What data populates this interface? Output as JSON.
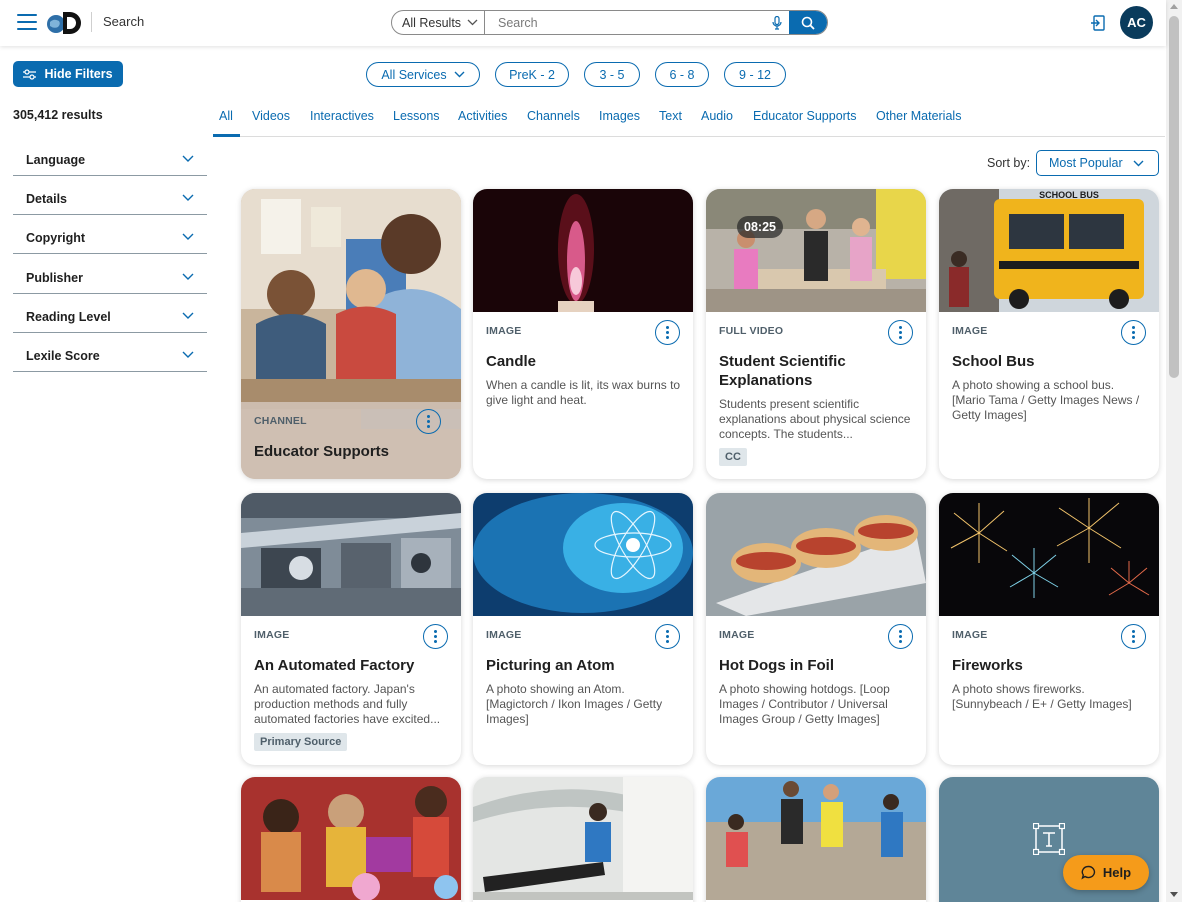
{
  "header": {
    "app_title": "Search",
    "search_scope": "All Results",
    "search_placeholder": "Search",
    "avatar_initials": "AC"
  },
  "filters_bar": {
    "hide_filters_label": "Hide Filters",
    "pills": [
      "All Services",
      "PreK - 2",
      "3 - 5",
      "6 - 8",
      "9 - 12"
    ]
  },
  "results_count": "305,412 results",
  "tabs": [
    "All",
    "Videos",
    "Interactives",
    "Lessons",
    "Activities",
    "Channels",
    "Images",
    "Text",
    "Audio",
    "Educator Supports",
    "Other Materials"
  ],
  "facets": [
    "Language",
    "Details",
    "Copyright",
    "Publisher",
    "Reading Level",
    "Lexile Score"
  ],
  "sort": {
    "label": "Sort by:",
    "value": "Most Popular"
  },
  "cards": [
    {
      "type": "CHANNEL",
      "title": "Educator Supports"
    },
    {
      "type": "IMAGE",
      "title": "Candle",
      "desc": "When a candle is lit, its wax burns to give light and heat."
    },
    {
      "type": "FULL VIDEO",
      "title": "Student Scientific Explanations",
      "desc": "Students present scientific explanations about physical science concepts. The students...",
      "duration": "08:25",
      "tag": "CC"
    },
    {
      "type": "IMAGE",
      "title": "School Bus",
      "desc": "A photo showing a school bus. [Mario Tama / Getty Images News / Getty Images]",
      "thumb_text": "SCHOOL BUS"
    },
    {
      "type": "IMAGE",
      "title": "An Automated Factory",
      "desc": "An automated factory. Japan's production methods and fully automated factories have excited...",
      "tag": "Primary Source"
    },
    {
      "type": "IMAGE",
      "title": "Picturing an Atom",
      "desc": "A photo showing an Atom. [Magictorch / Ikon Images / Getty Images]"
    },
    {
      "type": "IMAGE",
      "title": "Hot Dogs in Foil",
      "desc": "A photo showing hotdogs. [Loop Images / Contributor / Universal Images Group / Getty Images]"
    },
    {
      "type": "IMAGE",
      "title": "Fireworks",
      "desc": "A photo shows fireworks. [Sunnybeach / E+ / Getty Images]"
    }
  ],
  "help_label": "Help",
  "colors": {
    "primary": "#0a6bb0",
    "avatar": "#0a3b5c",
    "help": "#f59b1a"
  }
}
